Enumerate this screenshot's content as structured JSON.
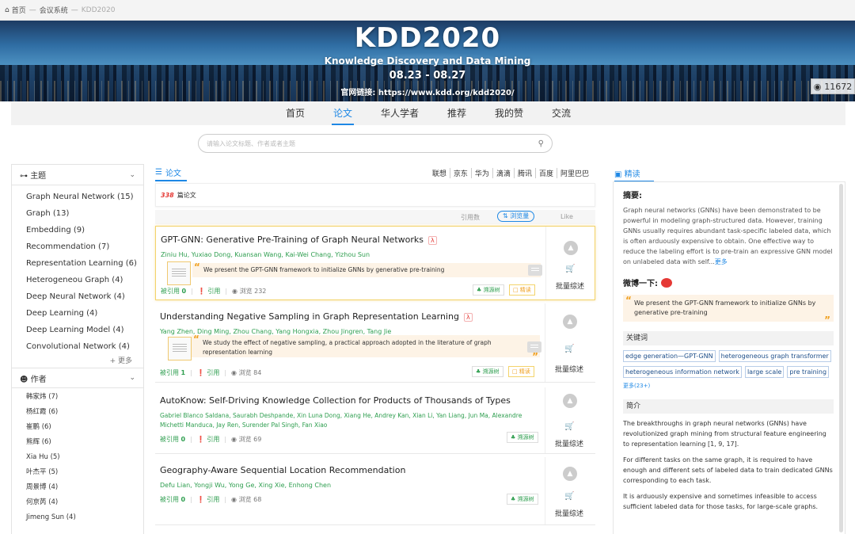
{
  "breadcrumb": {
    "home": "首页",
    "sep": "—",
    "section": "会议系统",
    "current": "KDD2020"
  },
  "banner": {
    "title": "KDD2020",
    "subtitle": "Knowledge Discovery and Data Mining",
    "dates": "08.23 - 08.27",
    "link": "官网链接: https://www.kdd.org/kdd2020/",
    "views": "11672"
  },
  "nav": [
    "首页",
    "论文",
    "华人学者",
    "推荐",
    "我的赞",
    "交流"
  ],
  "search": {
    "placeholder": "请输入论文标题、作者或者主题"
  },
  "sidebar": {
    "topic_header": "主题",
    "topics": [
      "Graph Neural Network (15)",
      "Graph (13)",
      "Embedding (9)",
      "Recommendation (7)",
      "Representation Learning (6)",
      "Heterogeneou Graph (4)",
      "Deep Neural Network (4)",
      "Deep Learning (4)",
      "Deep Learning Model (4)",
      "Convolutional Network (4)"
    ],
    "more": "+ 更多",
    "author_header": "作者",
    "authors": [
      "韩家炜 (7)",
      "杨红霞 (6)",
      "崔鹏 (6)",
      "熊辉 (6)",
      "Xia Hu (5)",
      "叶杰平 (5)",
      "周景博 (4)",
      "何京芮 (4)",
      "Jimeng Sun (4)"
    ]
  },
  "papers_panel": {
    "tab": "论文",
    "orgs": [
      "联想",
      "京东",
      "华为",
      "滴滴",
      "腾讯",
      "百度",
      "阿里巴巴"
    ],
    "count": "338",
    "count_suffix": "篇论文",
    "sort": {
      "cited": "引用数",
      "views": "⇅ 浏览量",
      "like": "Like"
    },
    "labels": {
      "cited_by": "被引用",
      "cite": "引用",
      "view": "浏览",
      "tree": "♣ 溯源树",
      "read": "精读",
      "bulk": "批量综述"
    },
    "papers": [
      {
        "title": "GPT-GNN: Generative Pre-Training of Graph Neural Networks",
        "authors": "Ziniu Hu, Yuxiao Dong, Kuansan Wang, Kai-Wei Chang, Yizhou Sun",
        "quote": "We present the GPT-GNN framework to initialize GNNs by generative pre-training",
        "cited": "0",
        "views": "232"
      },
      {
        "title": "Understanding Negative Sampling in Graph Representation Learning",
        "authors": "Yang Zhen, Ding Ming, Zhou Chang, Yang Hongxia, Zhou Jingren, Tang Jie",
        "quote": "We study the effect of negative sampling, a practical approach adopted in the literature of graph representation learning",
        "cited": "1",
        "views": "84"
      },
      {
        "title": "AutoKnow: Self-Driving Knowledge Collection for Products of Thousands of Types",
        "authors": "Gabriel Blanco Saldana, Saurabh Deshpande, Xin Luna Dong, Xiang He, Andrey Kan, Xian Li, Yan Liang, Jun Ma, Alexandre Michetti Manduca, Jay Ren, Surender Pal Singh, Fan Xiao",
        "cited": "0",
        "views": "69"
      },
      {
        "title": "Geography-Aware Sequential Location Recommendation",
        "authors": "Defu Lian, Yongji Wu, Yong Ge, Xing Xie, Enhong Chen",
        "cited": "0",
        "views": "68"
      }
    ]
  },
  "detail": {
    "tab": "精读",
    "abstract_h": "摘要:",
    "abstract": "Graph neural networks (GNNs) have been demonstrated to be powerful in modeling graph-structured data. However, training GNNs usually requires abundant task-specific labeled data, which is often arduously expensive to obtain. One effective way to reduce the labeling effort is to pre-train an expressive GNN model on unlabeled data with self...",
    "abstract_more": "更多",
    "weibo_h": "微博一下:",
    "weibo_quote": "We present the GPT-GNN framework to initialize GNNs by generative pre-training",
    "kw_h": "关键词",
    "keywords": [
      "edge generation—GPT-GNN",
      "heterogeneous graph transformer",
      "heterogeneous information network",
      "large scale",
      "pre training"
    ],
    "kw_more": "更多(23+)",
    "intro_h": "简介",
    "intro": [
      "The breakthroughs in graph neural networks (GNNs) have revolutionized graph mining from structural feature engineering to representation learning [1, 9, 17].",
      "For different tasks on the same graph, it is required to have enough and different sets of labeled data to train dedicated GNNs corresponding to each task.",
      "It is arduously expensive and sometimes infeasible to access sufficient labeled data for those tasks, for large-scale graphs."
    ]
  }
}
